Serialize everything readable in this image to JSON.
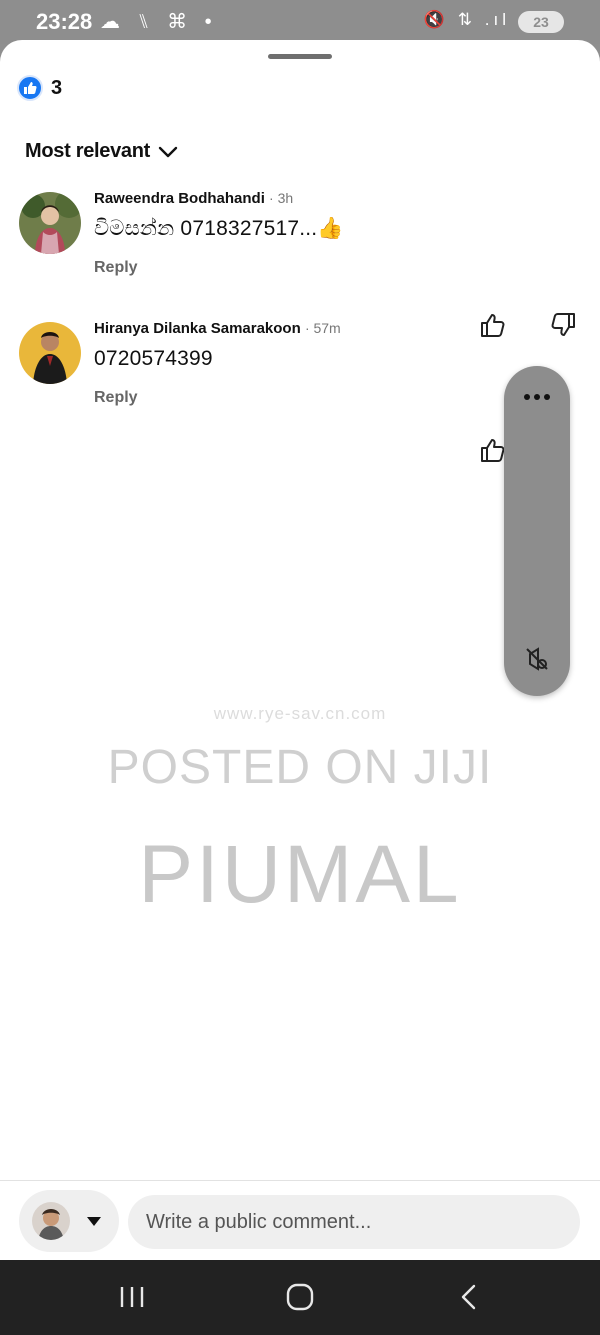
{
  "status_bar": {
    "time": "23:28",
    "left_icons_text": "☁ ⑊ ⌘ •",
    "right_icons_text": "🔇 ⇅ .ıl",
    "battery": "23"
  },
  "reactions": {
    "icon": "like-icon",
    "count": "3"
  },
  "sort": {
    "label": "Most relevant",
    "icon": "chevron-down-icon"
  },
  "comments": [
    {
      "author": "Raweendra Bodhahandi",
      "time": "· 3h",
      "text": "විමසන්න 0718327517...👍",
      "reply": "Reply"
    },
    {
      "author": "Hiranya Dilanka Samarakoon",
      "time": "· 57m",
      "text": "0720574399",
      "reply": "Reply"
    }
  ],
  "floating_pill": {
    "more_icon": "more-dots-icon",
    "mute_icon": "mute-icon"
  },
  "watermark": {
    "url": "www.rye-sav.cn.com",
    "line1": "POSTED ON JIJI",
    "line2": "PIUMAL"
  },
  "composer": {
    "placeholder": "Write a public comment..."
  },
  "colors": {
    "accent": "#1877f2",
    "statusbar": "#8e8e8e",
    "navbar": "#222222"
  }
}
